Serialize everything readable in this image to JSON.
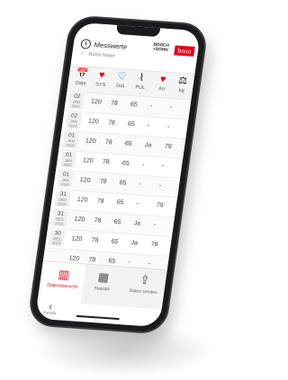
{
  "header": {
    "title": "Messwerte",
    "user": "Robin Maier",
    "brand_small": "BOSCH\n+SOHN",
    "brand": "boso"
  },
  "columns": [
    {
      "label": "Date",
      "icon": "calendar-icon",
      "glyph": "📅"
    },
    {
      "label": "SYS",
      "icon": "heart-filled-icon",
      "glyph": "♥",
      "color": "#e2001a"
    },
    {
      "label": "DIA",
      "icon": "heart-outline-icon",
      "glyph": "♡",
      "color": "#1a5fb4"
    },
    {
      "label": "PUL",
      "icon": "pulse-icon",
      "glyph": "⌇"
    },
    {
      "label": "Arr",
      "icon": "arrhythmia-heart-icon",
      "glyph": "♥",
      "color": "#e2001a"
    },
    {
      "label": "kg",
      "icon": "weight-icon",
      "glyph": "⚖"
    }
  ],
  "rows": [
    {
      "day": "02",
      "month": "JAN",
      "year": "2020",
      "sys": "120",
      "dia": "78",
      "pul": "65",
      "arr": "-",
      "kg": "-"
    },
    {
      "day": "02",
      "month": "JAN",
      "year": "2020",
      "sys": "120",
      "dia": "78",
      "pul": "65",
      "arr": "-",
      "kg": "-"
    },
    {
      "day": "01",
      "month": "JAN",
      "year": "2020",
      "sys": "120",
      "dia": "78",
      "pul": "65",
      "arr": "Ja",
      "kg": "79"
    },
    {
      "day": "01",
      "month": "JAN",
      "year": "2020",
      "sys": "120",
      "dia": "78",
      "pul": "65",
      "arr": "-",
      "kg": "-"
    },
    {
      "day": "01",
      "month": "JAN",
      "year": "2020",
      "sys": "120",
      "dia": "78",
      "pul": "65",
      "arr": "-",
      "kg": "-"
    },
    {
      "day": "31",
      "month": "DEZ",
      "year": "2019",
      "sys": "120",
      "dia": "78",
      "pul": "65",
      "arr": "-",
      "kg": "79"
    },
    {
      "day": "31",
      "month": "DEZ",
      "year": "2019",
      "sys": "120",
      "dia": "78",
      "pul": "65",
      "arr": "Ja",
      "kg": "-"
    },
    {
      "day": "30",
      "month": "DEZ",
      "year": "2019",
      "sys": "120",
      "dia": "78",
      "pul": "65",
      "arr": "Ja",
      "kg": "78"
    },
    {
      "day": "",
      "month": "",
      "year": "",
      "sys": "120",
      "dia": "78",
      "pul": "65",
      "arr": "-",
      "kg": "-"
    }
  ],
  "more_glyph": "∨",
  "tabs": [
    {
      "label": "Datenübersicht",
      "icon": "data-overview-icon",
      "glyph": "▥",
      "active": true
    },
    {
      "label": "Statistik",
      "icon": "statistics-icon",
      "glyph": "▦",
      "active": false
    },
    {
      "label": "Daten senden",
      "icon": "share-icon",
      "glyph": "⇪",
      "active": false
    }
  ],
  "back": {
    "label": "zurück",
    "glyph": "‹"
  }
}
